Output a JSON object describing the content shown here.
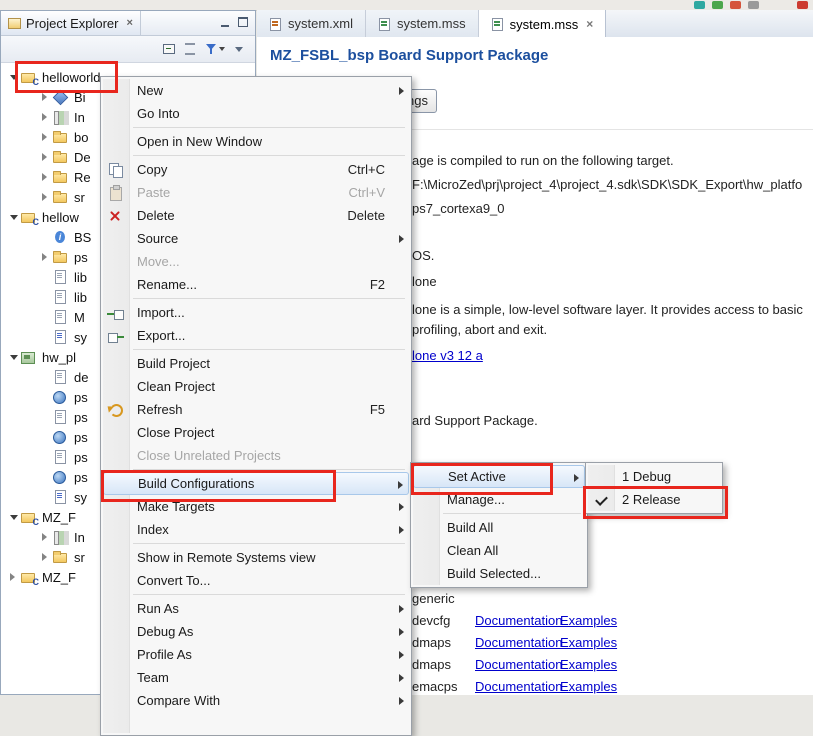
{
  "colors": {
    "annotation": "#e8261d",
    "page_title": "#1c4f9e",
    "link": "#0000cc"
  },
  "window": {
    "top_icons": [
      "teal-tool-icon",
      "green-tool-icon",
      "red-tool-icon",
      "gray-tool-icon",
      "red-tool-icon"
    ]
  },
  "project_explorer": {
    "tab_label": "Project Explorer",
    "toolbar_icons": [
      "collapse-all",
      "link-with-editor",
      "filter",
      "view-menu"
    ],
    "window_buttons": [
      "minimize",
      "maximize"
    ],
    "tree": [
      {
        "label": "helloworld",
        "icon": "c-project",
        "state": "expanded",
        "indent": 0,
        "annotated": true
      },
      {
        "label": "Bi",
        "icon": "binaries",
        "state": "collapsed",
        "indent": 1
      },
      {
        "label": "In",
        "icon": "includes",
        "state": "collapsed",
        "indent": 1
      },
      {
        "label": "bo",
        "icon": "folder",
        "state": "collapsed",
        "indent": 1
      },
      {
        "label": "De",
        "icon": "folder",
        "state": "collapsed",
        "indent": 1
      },
      {
        "label": "Re",
        "icon": "folder",
        "state": "collapsed",
        "indent": 1
      },
      {
        "label": "sr",
        "icon": "folder",
        "state": "collapsed",
        "indent": 1
      },
      {
        "label": "hellow",
        "icon": "c-project",
        "state": "expanded",
        "indent": 0
      },
      {
        "label": "BS",
        "icon": "info",
        "state": "none",
        "indent": 1
      },
      {
        "label": "ps",
        "icon": "folder",
        "state": "collapsed",
        "indent": 1
      },
      {
        "label": "lib",
        "icon": "file",
        "state": "none",
        "indent": 1
      },
      {
        "label": "lib",
        "icon": "file",
        "state": "none",
        "indent": 1
      },
      {
        "label": "M",
        "icon": "file",
        "state": "none",
        "indent": 1
      },
      {
        "label": "sy",
        "icon": "file-blue",
        "state": "none",
        "indent": 1
      },
      {
        "label": "hw_pl",
        "icon": "hw-project",
        "state": "expanded",
        "indent": 0
      },
      {
        "label": "de",
        "icon": "file",
        "state": "none",
        "indent": 1
      },
      {
        "label": "ps",
        "icon": "globe",
        "state": "none",
        "indent": 1
      },
      {
        "label": "ps",
        "icon": "file",
        "state": "none",
        "indent": 1
      },
      {
        "label": "ps",
        "icon": "globe",
        "state": "none",
        "indent": 1
      },
      {
        "label": "ps",
        "icon": "file",
        "state": "none",
        "indent": 1
      },
      {
        "label": "ps",
        "icon": "globe",
        "state": "none",
        "indent": 1
      },
      {
        "label": "sy",
        "icon": "file-blue",
        "state": "none",
        "indent": 1
      },
      {
        "label": "MZ_F",
        "icon": "c-project",
        "state": "expanded",
        "indent": 0
      },
      {
        "label": "In",
        "icon": "includes",
        "state": "collapsed",
        "indent": 1
      },
      {
        "label": "sr",
        "icon": "folder",
        "state": "collapsed",
        "indent": 1
      },
      {
        "label": "MZ_F",
        "icon": "c-project-closed",
        "state": "collapsed",
        "indent": 0
      }
    ]
  },
  "editor": {
    "tabs": [
      {
        "label": "system.xml",
        "icon": "xml"
      },
      {
        "label": "system.mss",
        "icon": "mss"
      },
      {
        "label": "system.mss",
        "icon": "mss",
        "state": "active",
        "closable": true
      }
    ],
    "page": {
      "title": "MZ_FSBL_bsp Board Support Package",
      "settings_button_fragment": "ngs",
      "lines": {
        "target": "age is compiled to run on the following target.",
        "hw_path": "F:\\MicroZed\\prj\\project_4\\project_4.sdk\\SDK\\SDK_Export\\hw_platfo",
        "processor": "ps7_cortexa9_0",
        "os": "OS.",
        "os_name": "lone",
        "desc1": "lone is a simple, low-level software layer. It provides access to basic",
        "desc2": "profiling, abort and exit.",
        "doc_link": "lone v3 12 a",
        "bsp": "ard Support Package."
      },
      "drivers": [
        {
          "driver": "generic",
          "documentation": "",
          "examples": ""
        },
        {
          "driver": "devcfg",
          "documentation": "Documentation",
          "examples": "Examples"
        },
        {
          "driver": "dmaps",
          "documentation": "Documentation",
          "examples": "Examples"
        },
        {
          "driver": "dmaps",
          "documentation": "Documentation",
          "examples": "Examples"
        },
        {
          "driver": "emacps",
          "documentation": "Documentation",
          "examples": "Examples"
        }
      ]
    }
  },
  "context_menu": {
    "items": [
      {
        "label": "New",
        "submenu": true
      },
      {
        "label": "Go Into",
        "divider_after": true
      },
      {
        "label": "Open in New Window",
        "divider_after": true
      },
      {
        "label": "Copy",
        "shortcut": "Ctrl+C",
        "icon": "copy"
      },
      {
        "label": "Paste",
        "shortcut": "Ctrl+V",
        "icon": "paste",
        "cls": "disabled"
      },
      {
        "label": "Delete",
        "shortcut": "Delete",
        "icon": "delete"
      },
      {
        "label": "Source",
        "submenu": true
      },
      {
        "label": "Move...",
        "cls": "disabled"
      },
      {
        "label": "Rename...",
        "shortcut": "F2",
        "divider_after": true
      },
      {
        "label": "Import...",
        "icon": "import"
      },
      {
        "label": "Export...",
        "icon": "export",
        "divider_after": true
      },
      {
        "label": "Build Project"
      },
      {
        "label": "Clean Project"
      },
      {
        "label": "Refresh",
        "shortcut": "F5",
        "icon": "refresh"
      },
      {
        "label": "Close Project"
      },
      {
        "label": "Close Unrelated Projects",
        "cls": "disabled",
        "divider_after": true
      },
      {
        "label": "Build Configurations",
        "submenu": true,
        "cls": "hover",
        "annotated": true
      },
      {
        "label": "Make Targets",
        "submenu": true
      },
      {
        "label": "Index",
        "submenu": true,
        "divider_after": true
      },
      {
        "label": "Show in Remote Systems view"
      },
      {
        "label": "Convert To...",
        "divider_after": true
      },
      {
        "label": "Run As",
        "submenu": true
      },
      {
        "label": "Debug As",
        "submenu": true
      },
      {
        "label": "Profile As",
        "submenu": true
      },
      {
        "label": "Team",
        "submenu": true
      },
      {
        "label": "Compare With",
        "submenu": true
      }
    ]
  },
  "build_configurations_submenu": {
    "items": [
      {
        "label": "Set Active",
        "submenu": true,
        "cls": "hover",
        "annotated": true
      },
      {
        "label": "Manage...",
        "divider_after": true
      },
      {
        "label": "Build All"
      },
      {
        "label": "Clean All"
      },
      {
        "label": "Build Selected..."
      }
    ]
  },
  "set_active_submenu": {
    "items": [
      {
        "label": "1 Debug"
      },
      {
        "label": "2 Release",
        "icon": "check",
        "annotated": true
      }
    ]
  }
}
